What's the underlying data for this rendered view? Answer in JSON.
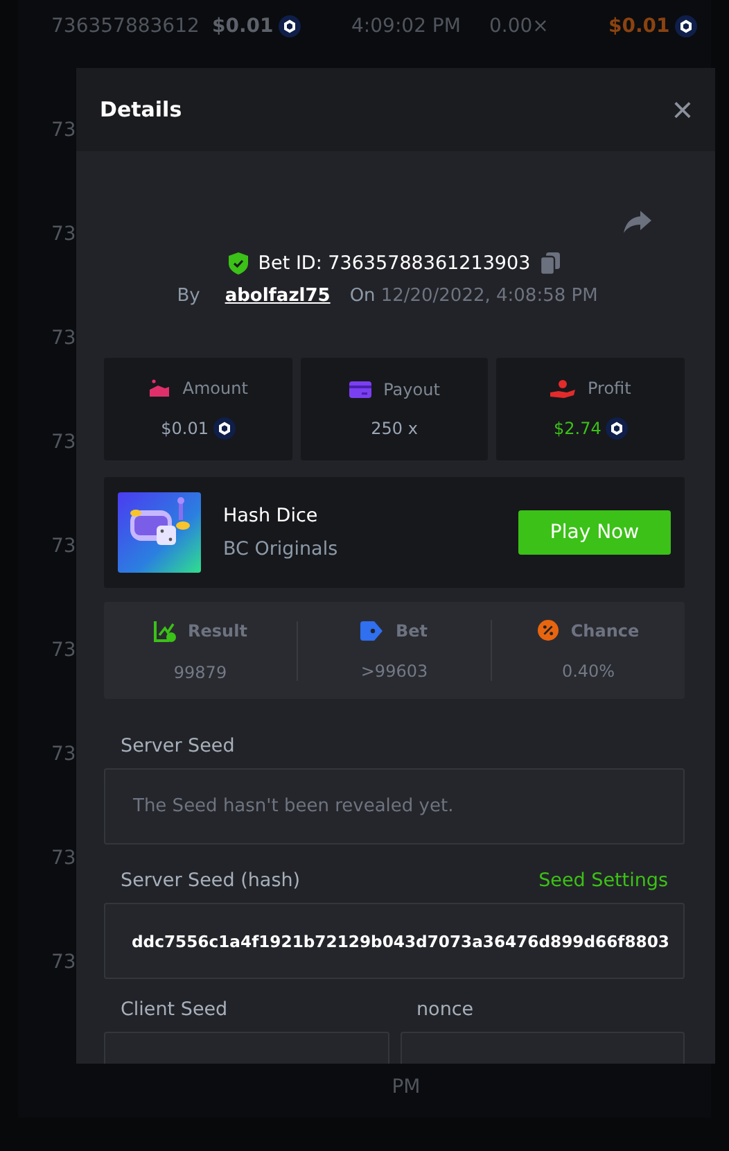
{
  "background_table": {
    "rows": [
      {
        "id": "736357883612",
        "amount": "$0.01",
        "time": "4:09:02 PM",
        "payout": "0.00×",
        "profit": "$0.01"
      },
      {
        "id": "73"
      },
      {
        "id": "73"
      },
      {
        "id": "73"
      },
      {
        "id": "73"
      },
      {
        "id": "73"
      },
      {
        "id": "73"
      },
      {
        "id": "73"
      },
      {
        "id": "73"
      },
      {
        "id": "73"
      },
      {
        "time": "PM"
      }
    ]
  },
  "modal": {
    "title": "Details",
    "close": "×",
    "bet_id": "Bet ID: 73635788361213903",
    "by_label": "By",
    "user": "abolfazl75",
    "on_label": "On",
    "date": "12/20/2022, 4:08:58 PM",
    "stats": [
      {
        "kind": "amount",
        "label": "Amount",
        "value": "$0.01",
        "coin": true,
        "color": "#9aa6b4"
      },
      {
        "kind": "payout",
        "label": "Payout",
        "value": "250 x",
        "coin": false,
        "color": "#9aa6b4"
      },
      {
        "kind": "profit",
        "label": "Profit",
        "value": "$2.74",
        "coin": true,
        "color": "#3bc117"
      }
    ],
    "game": {
      "name": "Hash Dice",
      "provider": "BC Originals",
      "button": "Play Now"
    },
    "outcome": [
      {
        "kind": "result",
        "label": "Result",
        "value": "99879"
      },
      {
        "kind": "bet",
        "label": "Bet",
        "value": ">99603"
      },
      {
        "kind": "chance",
        "label": "Chance",
        "value": "0.40%"
      }
    ],
    "server_seed": {
      "label": "Server Seed",
      "value": "The Seed hasn't been revealed yet."
    },
    "server_seed_hash": {
      "label": "Server Seed (hash)",
      "link": "Seed Settings",
      "value": "ddc7556c1a4f1921b72129b043d7073a36476d899d66f8803"
    },
    "client_seed": {
      "label": "Client Seed"
    },
    "nonce": {
      "label": "nonce"
    }
  }
}
